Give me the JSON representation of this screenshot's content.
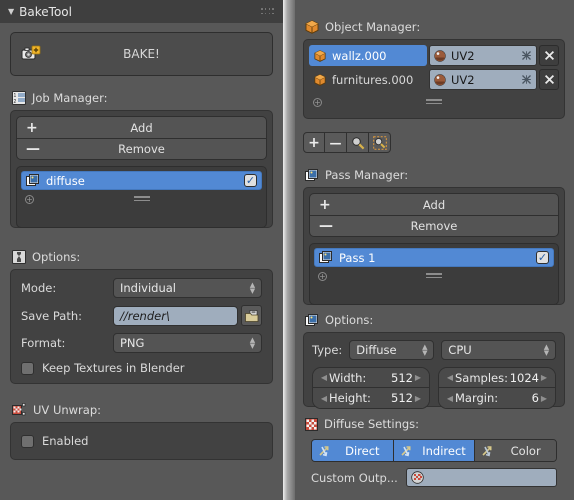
{
  "left": {
    "header": {
      "title": "BakeTool",
      "collapse_icon": "triangle-down-icon",
      "grip_icon": "grip-dots-icon"
    },
    "bake_button": {
      "label": "BAKE!",
      "icon": "camera-add-icon"
    },
    "job_manager": {
      "label": "Job Manager:",
      "icon": "list-numbered-icon",
      "add_label": "Add",
      "remove_label": "Remove",
      "add_sign": "+",
      "remove_sign": "—",
      "items": [
        {
          "name": "diffuse",
          "icon": "images-icon",
          "selected": true,
          "checked": true
        }
      ],
      "footer_add_icon": "plus-circle-icon",
      "footer_grip_icon": "grip-lines-icon"
    },
    "options": {
      "label": "Options:",
      "icon": "options-icon",
      "mode_label": "Mode:",
      "mode_value": "Individual",
      "save_path_label": "Save Path:",
      "save_path_value": "//render\\",
      "browse_icon": "folder-icon",
      "format_label": "Format:",
      "format_value": "PNG",
      "keep_textures_label": "Keep Textures in Blender",
      "keep_textures_checked": false
    },
    "uv_unwrap": {
      "label": "UV Unwrap:",
      "icon": "uv-unwrap-icon",
      "enabled_label": "Enabled",
      "enabled_checked": false
    }
  },
  "right": {
    "object_manager": {
      "label": "Object Manager:",
      "icon": "object-cube-icon",
      "rows": [
        {
          "name": "wallz.000",
          "icon": "object-cube-icon",
          "selected": true,
          "uv": "UV2",
          "uv_icon": "material-sphere-icon",
          "unlink_icon": "unlink-x-icon",
          "delete_icon": "close-x-icon"
        },
        {
          "name": "furnitures.000",
          "icon": "object-cube-icon",
          "selected": false,
          "uv": "UV2",
          "uv_icon": "material-sphere-icon",
          "unlink_icon": "unlink-x-icon",
          "delete_icon": "close-x-icon"
        }
      ],
      "footer_add_icon": "plus-circle-icon",
      "footer_grip_icon": "grip-lines-icon",
      "tools": [
        {
          "name": "add-object-button",
          "glyph": "+"
        },
        {
          "name": "remove-object-button",
          "glyph": "—"
        },
        {
          "name": "select-magnifier-button",
          "glyph": "magnifier-icon"
        },
        {
          "name": "select-region-magnifier-button",
          "glyph": "magnifier-region-icon"
        }
      ]
    },
    "pass_manager": {
      "label": "Pass Manager:",
      "icon": "images-icon",
      "add_label": "Add",
      "remove_label": "Remove",
      "add_sign": "+",
      "remove_sign": "—",
      "items": [
        {
          "name": "Pass 1",
          "icon": "images-icon",
          "selected": true,
          "checked": true
        }
      ],
      "footer_add_icon": "plus-circle-icon",
      "footer_grip_icon": "grip-lines-icon"
    },
    "options": {
      "label": "Options:",
      "icon": "images-icon",
      "type_label": "Type:",
      "type_value": "Diffuse",
      "device_value": "CPU",
      "width_label": "Width:",
      "width_value": "512",
      "height_label": "Height:",
      "height_value": "512",
      "samples_label": "Samples:",
      "samples_value": "1024",
      "margin_label": "Margin:",
      "margin_value": "6"
    },
    "diffuse_settings": {
      "label": "Diffuse Settings:",
      "icon": "checker-icon",
      "toggles": [
        {
          "label": "Direct",
          "icon": "bounce-arrows-icon",
          "on": true
        },
        {
          "label": "Indirect",
          "icon": "bounce-arrows-icon",
          "on": true
        },
        {
          "label": "Color",
          "icon": "bounce-arrows-icon",
          "on": false
        }
      ],
      "custom_output_label": "Custom Outp...",
      "custom_output_value": "",
      "custom_output_icon": "material-checker-sphere-icon"
    }
  },
  "colors": {
    "accent_blue": "#5289d4",
    "panel_bg": "#585858",
    "box_bg": "#424242",
    "header_bg": "#3f3f3f",
    "text_field_bg": "#9fadbd"
  }
}
